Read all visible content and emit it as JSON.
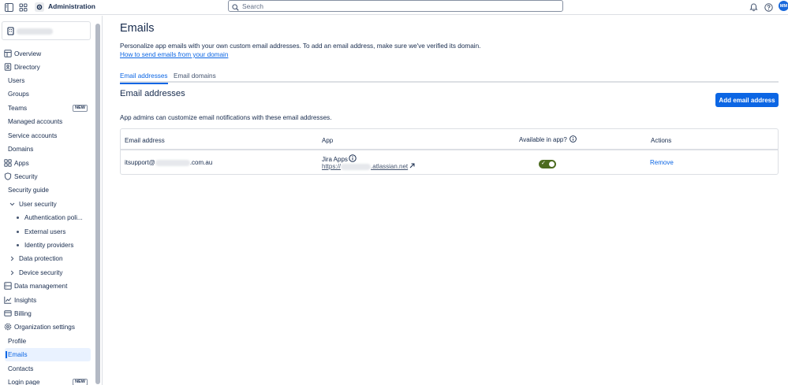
{
  "topbar": {
    "app_title": "Administration",
    "search_placeholder": "Search",
    "avatar_initials": "MM"
  },
  "sidebar": {
    "org_name": "",
    "items": [
      {
        "label": "Overview",
        "icon": "overview-icon"
      },
      {
        "label": "Directory",
        "icon": "directory-icon"
      },
      {
        "label": "Users"
      },
      {
        "label": "Groups"
      },
      {
        "label": "Teams",
        "badge": "NEW"
      },
      {
        "label": "Managed accounts"
      },
      {
        "label": "Service accounts"
      },
      {
        "label": "Domains"
      },
      {
        "label": "Apps",
        "icon": "apps-icon"
      },
      {
        "label": "Security",
        "icon": "shield-icon"
      },
      {
        "label": "Security guide"
      },
      {
        "label": "User security"
      },
      {
        "label": "Authentication poli..."
      },
      {
        "label": "External users"
      },
      {
        "label": "Identity providers"
      },
      {
        "label": "Data protection"
      },
      {
        "label": "Device security"
      },
      {
        "label": "Data management",
        "icon": "database-icon"
      },
      {
        "label": "Insights",
        "icon": "chart-icon"
      },
      {
        "label": "Billing",
        "icon": "billing-icon"
      },
      {
        "label": "Organization settings",
        "icon": "gear-icon"
      },
      {
        "label": "Profile"
      },
      {
        "label": "Emails",
        "active": true
      },
      {
        "label": "Contacts"
      },
      {
        "label": "Login page",
        "badge": "NEW"
      }
    ]
  },
  "main": {
    "title": "Emails",
    "description": "Personalize app emails with your own custom email addresses. To add an email address, make sure we've verified its domain.",
    "help_link": "How to send emails from your domain",
    "tabs": [
      {
        "label": "Email addresses",
        "active": true
      },
      {
        "label": "Email domains",
        "active": false
      }
    ],
    "section_title": "Email addresses",
    "add_button": "Add email address",
    "subtitle": "App admins can customize email notifications with these email addresses.",
    "table": {
      "headers": [
        "Email address",
        "App",
        "Available in app?",
        "Actions"
      ],
      "rows": [
        {
          "email_prefix": "itsupport@",
          "email_suffix": ".com.au",
          "app_name": "Jira Apps",
          "app_url_prefix": "https://",
          "app_url_suffix": ".atlassian.net",
          "available": true,
          "action": "Remove"
        }
      ]
    }
  },
  "colors": {
    "primary": "#0c66e4",
    "toggle_on": "#4c6b1f",
    "border": "#dcdfe4",
    "text": "#172b4d"
  }
}
